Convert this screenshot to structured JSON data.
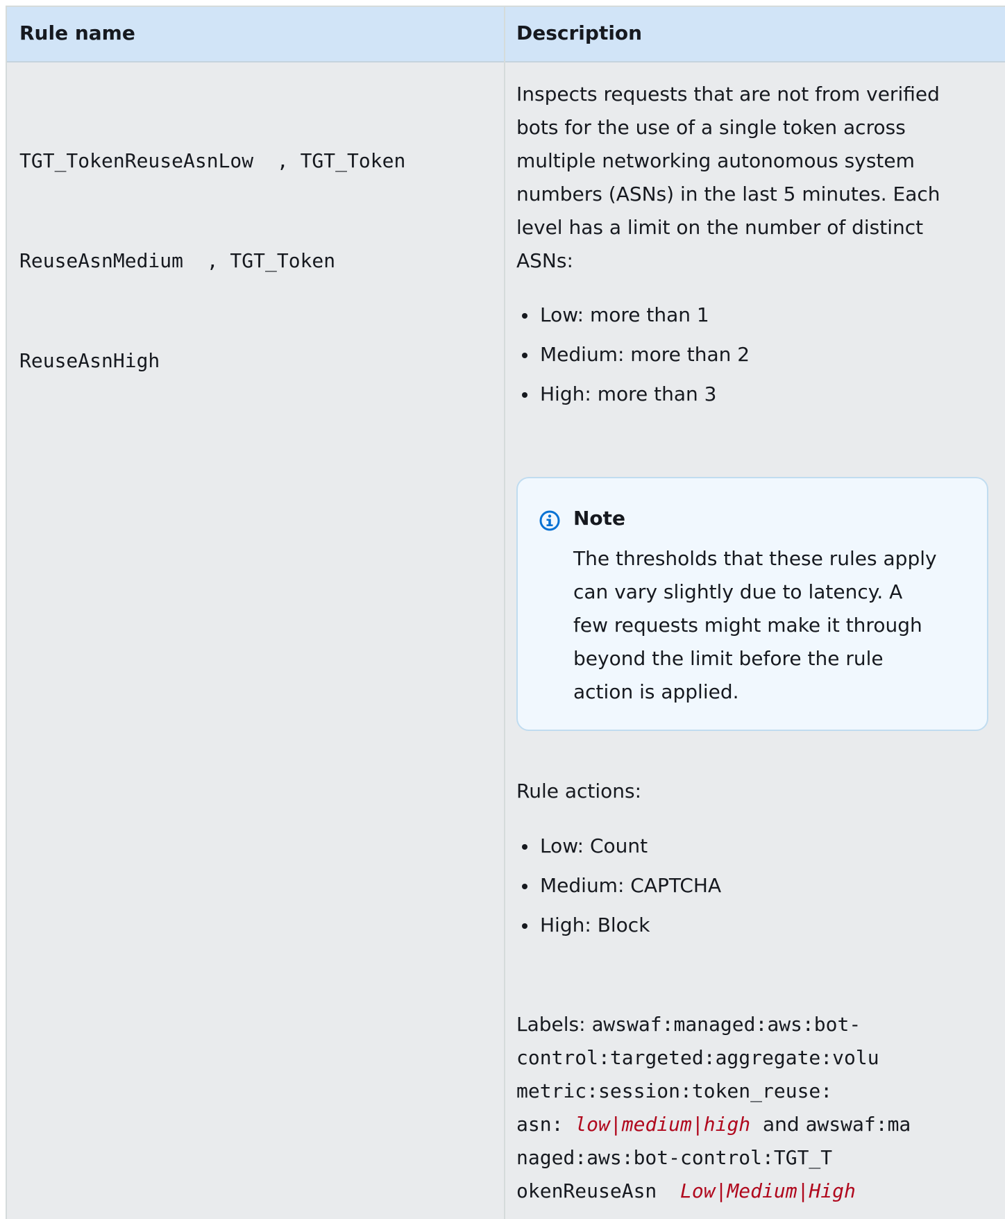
{
  "table": {
    "headers": {
      "rule_name": "Rule name",
      "description": "Description"
    },
    "rule_name_lines": [
      "TGT_TokenReuseAsnLow  , TGT_Token",
      "ReuseAsnMedium  , TGT_Token",
      "ReuseAsnHigh"
    ],
    "description_lines": [
      "Inspects requests that are not from verified",
      "bots for the use of a single token across",
      "multiple networking autonomous system",
      "numbers (ASNs) in the last 5 minutes. Each",
      "level has a limit on the number of distinct",
      "ASNs:"
    ],
    "limits": [
      "Low: more than 1",
      "Medium: more than 2",
      "High: more than 3"
    ],
    "note": {
      "icon": "info-icon",
      "title": "Note",
      "lines": [
        "The thresholds that these rules apply",
        "can vary  slightly due to latency. A",
        "few requests might make  it through",
        "beyond the limit before the rule",
        "action   is applied."
      ]
    },
    "rule_actions_label": "Rule actions:",
    "actions": [
      "Low: Count",
      "Medium: CAPTCHA",
      "High: Block"
    ],
    "labels": {
      "prefix": "Labels: ",
      "label1_line1": "awswaf:managed:aws:bot-",
      "label1_line2": "control:targeted:aggregate:volu",
      "label1_line3": "metric:session:token_reuse:",
      "label1_line4": "asn: ",
      "label1_var": "low|medium|high",
      "connector": "  and ",
      "label2_line1": "awswaf:ma",
      "label2_line2": "naged:aws:bot-control:TGT_T",
      "label2_line3": "okenReuseAsn  ",
      "label2_var": "Low|Medium|High"
    },
    "colors": {
      "header_bg": "#d1e4f7",
      "row_bg": "#e9ebed",
      "note_bg": "#f1f8fe",
      "note_border": "#c0dcf0",
      "variable_text": "#b0081d",
      "info_icon": "#0972d3"
    }
  }
}
